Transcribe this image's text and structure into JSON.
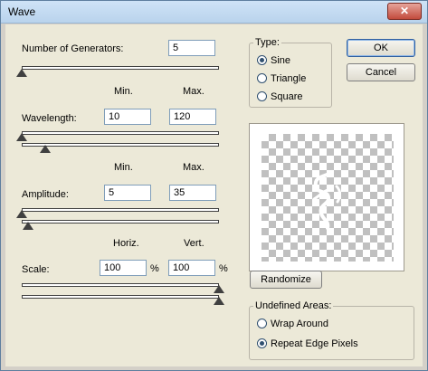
{
  "window": {
    "title": "Wave",
    "close_label": "✕"
  },
  "generators": {
    "label": "Number of Generators:",
    "value": "5",
    "slider_fraction": 0.0
  },
  "wavelength": {
    "min_header": "Min.",
    "max_header": "Max.",
    "label": "Wavelength:",
    "min": "10",
    "max": "120",
    "min_slider_fraction": 0.0,
    "max_slider_fraction": 0.12
  },
  "amplitude": {
    "min_header": "Min.",
    "max_header": "Max.",
    "label": "Amplitude:",
    "min": "5",
    "max": "35",
    "min_slider_fraction": 0.0,
    "max_slider_fraction": 0.03
  },
  "scale": {
    "horiz_header": "Horiz.",
    "vert_header": "Vert.",
    "label": "Scale:",
    "horiz": "100",
    "vert": "100",
    "percent": "%",
    "horiz_slider_fraction": 1.0,
    "vert_slider_fraction": 1.0
  },
  "type_group": {
    "title": "Type:",
    "options": [
      "Sine",
      "Triangle",
      "Square"
    ],
    "selected": "Sine"
  },
  "buttons": {
    "ok": "OK",
    "cancel": "Cancel",
    "randomize": "Randomize"
  },
  "undefined_group": {
    "title": "Undefined Areas:",
    "options": [
      "Wrap Around",
      "Repeat Edge Pixels"
    ],
    "selected": "Repeat Edge Pixels"
  },
  "colors": {
    "title_bar": "#c7dcf2",
    "dialog_bg": "#ece9d8",
    "close_button": "#c24b3c",
    "default_button_border": "#2f5f9f"
  }
}
